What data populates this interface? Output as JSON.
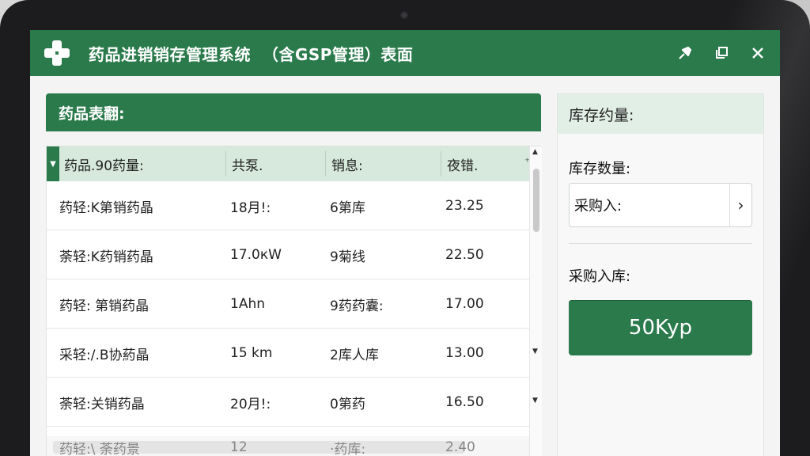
{
  "window": {
    "title": "药品进销销存管理系统  （含GSP管理）表面",
    "accent_color": "#2a7a4b",
    "controls": [
      "pin-icon",
      "restore-icon",
      "close-icon"
    ]
  },
  "main": {
    "panel_title": "药品表翻:",
    "table": {
      "columns": [
        "药品.90药量:",
        "共泵.",
        "销息:",
        "夜错."
      ],
      "rows": [
        [
          "药轻:K第销药晶",
          "18月!:",
          "6第库",
          "23.25"
        ],
        [
          "荼轻:K药销药晶",
          "17.0кW",
          "9菊线",
          "22.50"
        ],
        [
          "药轻: 第销药晶",
          "1Аhn",
          "9药药囊:",
          "17.00"
        ],
        [
          "采轻:/.B协葯晶",
          "15 km",
          "2库人库",
          "13.00"
        ],
        [
          "荼轻:关销药晶",
          "20月!:",
          "0第药",
          "16.50"
        ],
        [
          "药轻:\\ 荼药景",
          "12",
          "·药库:",
          "2.40"
        ]
      ]
    }
  },
  "side": {
    "title": "库存约量:",
    "quantity_label": "库存数量:",
    "select_value": "采购入:",
    "stock_in_label": "采购入库:",
    "action_button": "50Kyp"
  }
}
